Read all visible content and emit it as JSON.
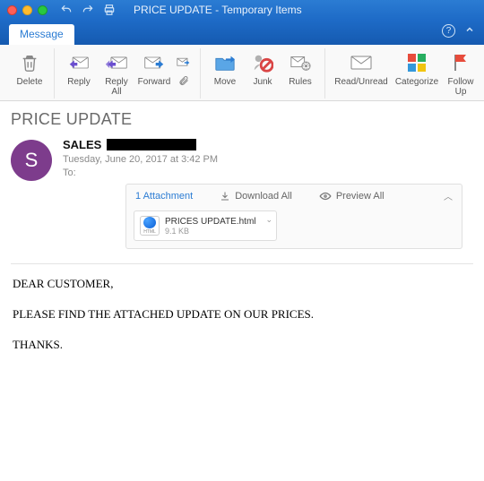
{
  "window": {
    "title": "PRICE UPDATE - Temporary Items"
  },
  "tab": {
    "message": "Message"
  },
  "ribbon": {
    "delete": "Delete",
    "reply": "Reply",
    "reply_all": "Reply\nAll",
    "forward": "Forward",
    "move": "Move",
    "junk": "Junk",
    "rules": "Rules",
    "read_unread": "Read/Unread",
    "categorize": "Categorize",
    "follow_up": "Follow\nUp"
  },
  "subject": "PRICE UPDATE",
  "header": {
    "from_name": "SALES",
    "avatar_initial": "S",
    "date": "Tuesday, June 20, 2017 at 3:42 PM",
    "to_label": "To:"
  },
  "attachments": {
    "count_label": "1 Attachment",
    "download_all": "Download All",
    "preview_all": "Preview All",
    "items": [
      {
        "name": "PRICES UPDATE.html",
        "size": "9.1 KB",
        "type_label": "HTML"
      }
    ]
  },
  "body": {
    "p1": "DEAR CUSTOMER,",
    "p2": "PLEASE FIND THE ATTACHED UPDATE ON OUR PRICES.",
    "p3": "THANKS."
  }
}
